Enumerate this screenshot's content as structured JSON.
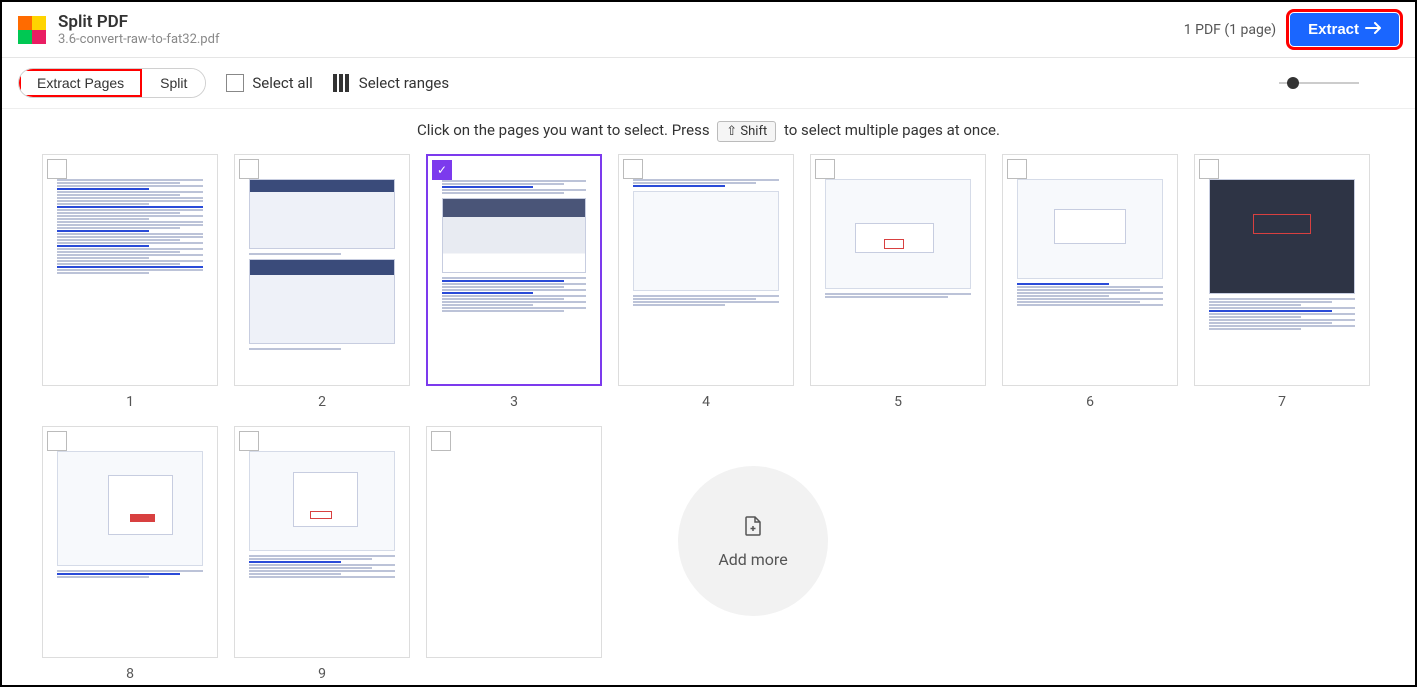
{
  "header": {
    "title": "Split PDF",
    "filename": "3.6-convert-raw-to-fat32.pdf",
    "status": "1 PDF (1 page)",
    "extract_label": "Extract"
  },
  "toolbar": {
    "extract_pages": "Extract Pages",
    "split": "Split",
    "select_all": "Select all",
    "select_ranges": "Select ranges"
  },
  "hint": {
    "prefix": "Click on the pages you want to select. Press",
    "key": "⇧ Shift",
    "suffix": "to select multiple pages at once."
  },
  "pages": {
    "p1": "1",
    "p2": "2",
    "p3": "3",
    "p4": "4",
    "p5": "5",
    "p6": "6",
    "p7": "7",
    "p8": "8",
    "p9": "9"
  },
  "add_more": "Add more",
  "selected_page": 3
}
